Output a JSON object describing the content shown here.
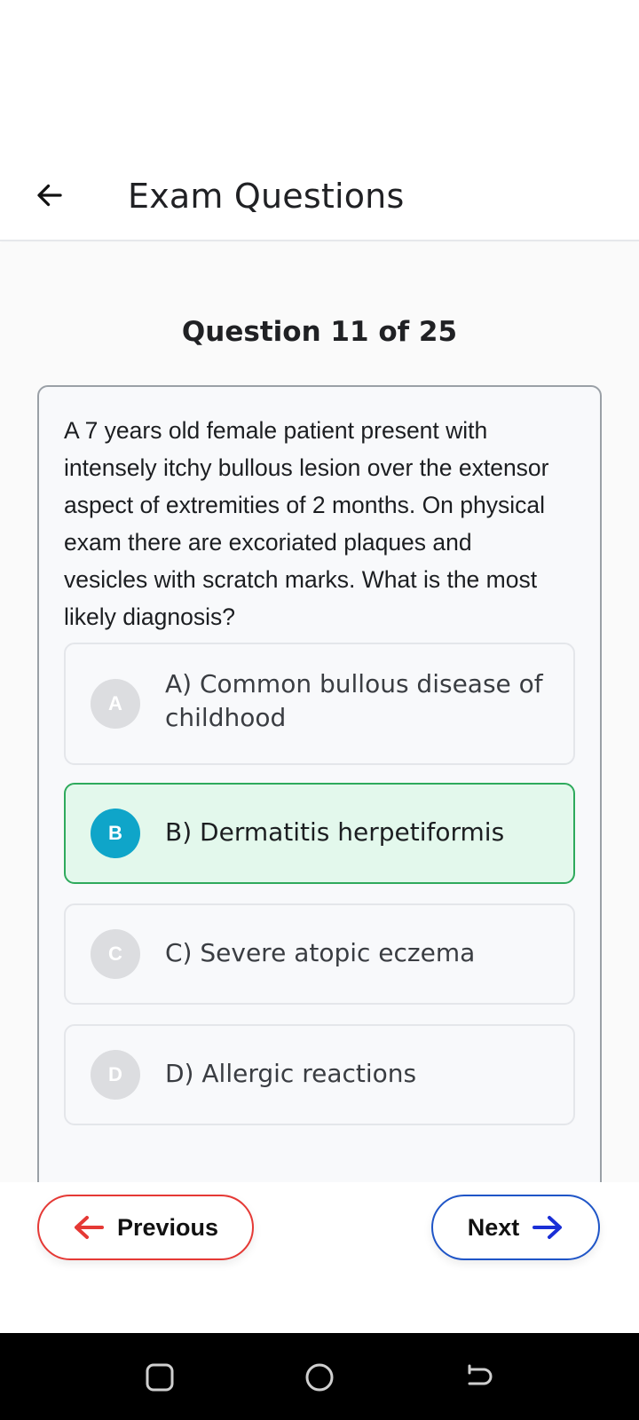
{
  "header": {
    "title": "Exam Questions"
  },
  "progress": {
    "text": "Question 11 of 25"
  },
  "question": {
    "text": "A 7 years old female patient present with intensely itchy bullous lesion over the extensor aspect of extremities of 2 months. On physical exam there are excoriated plaques and vesicles with scratch marks. What is the most likely diagnosis?"
  },
  "options": [
    {
      "letter": "A",
      "text": "A) Common bullous disease of childhood",
      "selected": false
    },
    {
      "letter": "B",
      "text": "B) Dermatitis herpetiformis",
      "selected": true
    },
    {
      "letter": "C",
      "text": "C) Severe atopic eczema",
      "selected": false
    },
    {
      "letter": "D",
      "text": "D) Allergic reactions",
      "selected": false
    }
  ],
  "nav": {
    "previous_label": "Previous",
    "next_label": "Next"
  },
  "colors": {
    "selected_border": "#2eaa5c",
    "selected_background": "#e3f8ec",
    "selected_badge": "#0fa5c9",
    "previous_accent": "#e53935",
    "next_accent": "#1f55c7"
  },
  "icons": {
    "back": "arrow-left-icon",
    "previous": "arrow-left-icon",
    "next": "arrow-right-icon",
    "system_recents": "square-icon",
    "system_home": "circle-icon",
    "system_back": "back-curve-icon"
  }
}
